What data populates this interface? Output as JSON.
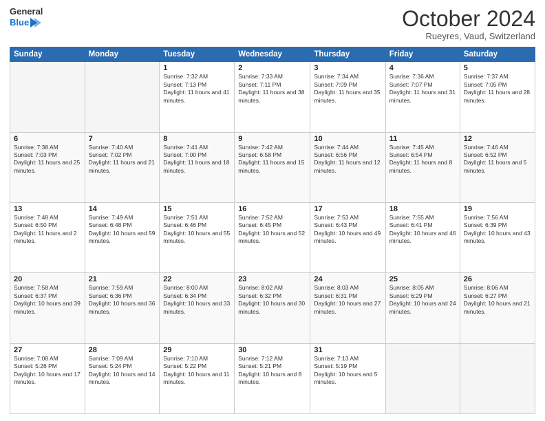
{
  "header": {
    "logo_line1": "General",
    "logo_line2": "Blue",
    "month_title": "October 2024",
    "location": "Rueyres, Vaud, Switzerland"
  },
  "columns": [
    "Sunday",
    "Monday",
    "Tuesday",
    "Wednesday",
    "Thursday",
    "Friday",
    "Saturday"
  ],
  "weeks": [
    [
      {
        "day": "",
        "info": ""
      },
      {
        "day": "",
        "info": ""
      },
      {
        "day": "1",
        "info": "Sunrise: 7:32 AM\nSunset: 7:13 PM\nDaylight: 11 hours and 41 minutes."
      },
      {
        "day": "2",
        "info": "Sunrise: 7:33 AM\nSunset: 7:11 PM\nDaylight: 11 hours and 38 minutes."
      },
      {
        "day": "3",
        "info": "Sunrise: 7:34 AM\nSunset: 7:09 PM\nDaylight: 11 hours and 35 minutes."
      },
      {
        "day": "4",
        "info": "Sunrise: 7:36 AM\nSunset: 7:07 PM\nDaylight: 11 hours and 31 minutes."
      },
      {
        "day": "5",
        "info": "Sunrise: 7:37 AM\nSunset: 7:05 PM\nDaylight: 11 hours and 28 minutes."
      }
    ],
    [
      {
        "day": "6",
        "info": "Sunrise: 7:38 AM\nSunset: 7:03 PM\nDaylight: 11 hours and 25 minutes."
      },
      {
        "day": "7",
        "info": "Sunrise: 7:40 AM\nSunset: 7:02 PM\nDaylight: 11 hours and 21 minutes."
      },
      {
        "day": "8",
        "info": "Sunrise: 7:41 AM\nSunset: 7:00 PM\nDaylight: 11 hours and 18 minutes."
      },
      {
        "day": "9",
        "info": "Sunrise: 7:42 AM\nSunset: 6:58 PM\nDaylight: 11 hours and 15 minutes."
      },
      {
        "day": "10",
        "info": "Sunrise: 7:44 AM\nSunset: 6:56 PM\nDaylight: 11 hours and 12 minutes."
      },
      {
        "day": "11",
        "info": "Sunrise: 7:45 AM\nSunset: 6:54 PM\nDaylight: 11 hours and 8 minutes."
      },
      {
        "day": "12",
        "info": "Sunrise: 7:46 AM\nSunset: 6:52 PM\nDaylight: 11 hours and 5 minutes."
      }
    ],
    [
      {
        "day": "13",
        "info": "Sunrise: 7:48 AM\nSunset: 6:50 PM\nDaylight: 11 hours and 2 minutes."
      },
      {
        "day": "14",
        "info": "Sunrise: 7:49 AM\nSunset: 6:48 PM\nDaylight: 10 hours and 59 minutes."
      },
      {
        "day": "15",
        "info": "Sunrise: 7:51 AM\nSunset: 6:46 PM\nDaylight: 10 hours and 55 minutes."
      },
      {
        "day": "16",
        "info": "Sunrise: 7:52 AM\nSunset: 6:45 PM\nDaylight: 10 hours and 52 minutes."
      },
      {
        "day": "17",
        "info": "Sunrise: 7:53 AM\nSunset: 6:43 PM\nDaylight: 10 hours and 49 minutes."
      },
      {
        "day": "18",
        "info": "Sunrise: 7:55 AM\nSunset: 6:41 PM\nDaylight: 10 hours and 46 minutes."
      },
      {
        "day": "19",
        "info": "Sunrise: 7:56 AM\nSunset: 6:39 PM\nDaylight: 10 hours and 43 minutes."
      }
    ],
    [
      {
        "day": "20",
        "info": "Sunrise: 7:58 AM\nSunset: 6:37 PM\nDaylight: 10 hours and 39 minutes."
      },
      {
        "day": "21",
        "info": "Sunrise: 7:59 AM\nSunset: 6:36 PM\nDaylight: 10 hours and 36 minutes."
      },
      {
        "day": "22",
        "info": "Sunrise: 8:00 AM\nSunset: 6:34 PM\nDaylight: 10 hours and 33 minutes."
      },
      {
        "day": "23",
        "info": "Sunrise: 8:02 AM\nSunset: 6:32 PM\nDaylight: 10 hours and 30 minutes."
      },
      {
        "day": "24",
        "info": "Sunrise: 8:03 AM\nSunset: 6:31 PM\nDaylight: 10 hours and 27 minutes."
      },
      {
        "day": "25",
        "info": "Sunrise: 8:05 AM\nSunset: 6:29 PM\nDaylight: 10 hours and 24 minutes."
      },
      {
        "day": "26",
        "info": "Sunrise: 8:06 AM\nSunset: 6:27 PM\nDaylight: 10 hours and 21 minutes."
      }
    ],
    [
      {
        "day": "27",
        "info": "Sunrise: 7:08 AM\nSunset: 5:26 PM\nDaylight: 10 hours and 17 minutes."
      },
      {
        "day": "28",
        "info": "Sunrise: 7:09 AM\nSunset: 5:24 PM\nDaylight: 10 hours and 14 minutes."
      },
      {
        "day": "29",
        "info": "Sunrise: 7:10 AM\nSunset: 5:22 PM\nDaylight: 10 hours and 11 minutes."
      },
      {
        "day": "30",
        "info": "Sunrise: 7:12 AM\nSunset: 5:21 PM\nDaylight: 10 hours and 8 minutes."
      },
      {
        "day": "31",
        "info": "Sunrise: 7:13 AM\nSunset: 5:19 PM\nDaylight: 10 hours and 5 minutes."
      },
      {
        "day": "",
        "info": ""
      },
      {
        "day": "",
        "info": ""
      }
    ]
  ]
}
